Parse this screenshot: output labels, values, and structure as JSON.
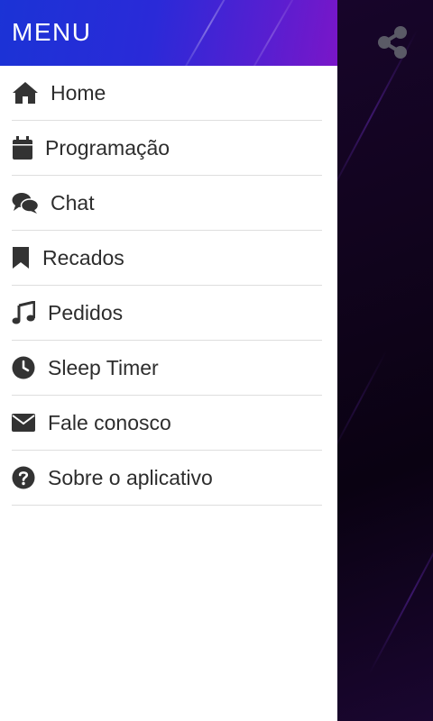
{
  "drawer": {
    "title": "MENU",
    "items": [
      {
        "label": "Home",
        "icon": "home-icon"
      },
      {
        "label": "Programação",
        "icon": "calendar-icon"
      },
      {
        "label": "Chat",
        "icon": "chat-icon"
      },
      {
        "label": "Recados",
        "icon": "bookmark-icon"
      },
      {
        "label": "Pedidos",
        "icon": "music-note-icon"
      },
      {
        "label": "Sleep Timer",
        "icon": "clock-icon"
      },
      {
        "label": "Fale conosco",
        "icon": "envelope-icon"
      },
      {
        "label": "Sobre o aplicativo",
        "icon": "question-circle-icon"
      }
    ]
  },
  "toolbar": {
    "share_icon": "share-icon"
  },
  "colors": {
    "header_gradient_start": "#1b33d6",
    "header_gradient_end": "#7a16c8",
    "background": "#12041f",
    "icon": "#333333",
    "share_icon": "#5a5a66"
  }
}
